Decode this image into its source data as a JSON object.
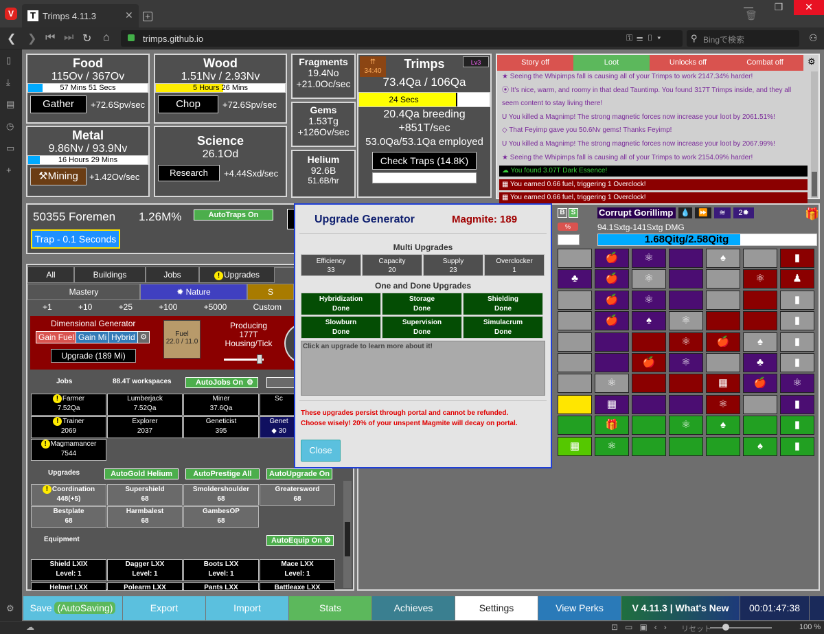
{
  "browser": {
    "tab_title": "Trimps 4.11.3",
    "url": "trimps.github.io",
    "search_placeholder": "Bingで検索",
    "vivaldi_letter": "V",
    "tab_icon_letter": "T",
    "zoom": "100 %",
    "reset_label": "リセット"
  },
  "resources": {
    "food": {
      "title": "Food",
      "amount": "115Ov / 367Ov",
      "bar_text": "57 Mins 51 Secs",
      "bar_fill": 0.12,
      "button": "Gather",
      "rate": "+72.6Spv/sec"
    },
    "wood": {
      "title": "Wood",
      "amount": "1.51Nv / 2.93Nv",
      "bar_text": "5 Hours 26 Mins",
      "bar_fill": 0.52,
      "button": "Chop",
      "rate": "+72.6Spv/sec"
    },
    "metal": {
      "title": "Metal",
      "amount": "9.86Nv / 93.9Nv",
      "bar_text": "16 Hours 29 Mins",
      "bar_fill": 0.1,
      "button": "Mining",
      "rate": "+1.42Ov/sec"
    },
    "science": {
      "title": "Science",
      "amount": "26.1Od",
      "button": "Research",
      "rate": "+4.44Sxd/sec"
    },
    "fragments": {
      "title": "Fragments",
      "amount": "19.4No",
      "rate": "+21.0Oc/sec"
    },
    "gems": {
      "title": "Gems",
      "amount": "1.53Tg",
      "rate": "+126Ov/sec"
    },
    "helium": {
      "title": "Helium",
      "amount": "92.6B",
      "rate": "51.6B/hr"
    }
  },
  "trimps": {
    "title": "Trimps",
    "timer": "34:40",
    "level": "Lv3",
    "amount": "73.4Qa / 106Qa",
    "bar_text": "24 Secs",
    "bar_fill": 0.75,
    "breeding": "20.4Qa breeding",
    "rate": "+851T/sec",
    "employed": "53.0Qa/53.1Qa employed",
    "check_traps": "Check Traps (14.8K)"
  },
  "log": {
    "filters": [
      "Story off",
      "Loot",
      "Unlocks off",
      "Combat off"
    ],
    "filter_colors": [
      "#d9534f",
      "#5cb85c",
      "#d9534f",
      "#d9534f"
    ],
    "rows": [
      {
        "text": "★ Seeing the Whipimps fall is causing all of your Trimps to work 2147.34% harder!",
        "color": "#7a2a9a",
        "bg": "#d0d0d0"
      },
      {
        "text": "⦿ It's nice, warm, and roomy in that dead Tauntimp. You found 317T Trimps inside, and they all",
        "color": "#7a2a9a",
        "bg": "#d0d0d0"
      },
      {
        "text": "seem content to stay living there!",
        "color": "#7a2a9a",
        "bg": "#d0d0d0"
      },
      {
        "text": "U You killed a Magnimp! The strong magnetic forces now increase your loot by 2061.51%!",
        "color": "#7a2a9a",
        "bg": "#d0d0d0"
      },
      {
        "text": "◇ That Feyimp gave you 50.6Nv gems! Thanks Feyimp!",
        "color": "#7a2a9a",
        "bg": "#d0d0d0"
      },
      {
        "text": "U You killed a Magnimp! The strong magnetic forces now increase your loot by 2067.99%!",
        "color": "#7a2a9a",
        "bg": "#d0d0d0"
      },
      {
        "text": "★ Seeing the Whipimps fall is causing all of your Trimps to work 2154.09% harder!",
        "color": "#7a2a9a",
        "bg": "#d0d0d0"
      },
      {
        "text": "☁ You found 3.07T Dark Essence!",
        "color": "#38d038",
        "bg": "#000"
      },
      {
        "text": "▦ You earned 0.66 fuel, triggering 1 Overclock!",
        "color": "#fff",
        "bg": "#8b0000"
      },
      {
        "text": "▦ You earned 0.66 fuel, triggering 1 Overclock!",
        "color": "#fff",
        "bg": "#8b0000"
      }
    ]
  },
  "foremen": {
    "label": "50355 Foremen",
    "percent": "1.26M%",
    "autotraps": "AutoTraps On",
    "trap": "Trap - 0.1 Seconds"
  },
  "tabs": {
    "row1": [
      "All",
      "Buildings",
      "Jobs",
      "Upgrades"
    ],
    "row2": [
      "Mastery",
      "✹ Nature",
      "S"
    ],
    "amounts": [
      "+1",
      "+10",
      "+25",
      "+100",
      "+5000",
      "Custom"
    ]
  },
  "dimgen": {
    "title": "Dimensional Generator",
    "gain_fuel": "Gain Fuel",
    "gain_mi": "Gain Mi",
    "hybrid": "Hybrid",
    "upgrade": "Upgrade (189 Mi)",
    "fuel_label": "Fuel",
    "fuel_value": "22.0 / 11.0",
    "producing": "Producing",
    "producing_value": "177T",
    "housing": "Housing/Tick"
  },
  "jobs": {
    "label": "Jobs",
    "workspaces": "88.4T workspaces",
    "autojobs": "AutoJobs On",
    "cells": [
      {
        "name": "Farmer",
        "value": "7.52Qa",
        "alert": true
      },
      {
        "name": "Lumberjack",
        "value": "7.52Qa",
        "alert": false
      },
      {
        "name": "Miner",
        "value": "37.6Qa",
        "alert": false
      },
      {
        "name": "Sc",
        "value": "",
        "alert": false
      },
      {
        "name": "Trainer",
        "value": "2069",
        "alert": true
      },
      {
        "name": "Explorer",
        "value": "2037",
        "alert": false
      },
      {
        "name": "Geneticist",
        "value": "395",
        "alert": false
      },
      {
        "name": "Genet",
        "value": "◆ 30",
        "alert": false
      },
      {
        "name": "Magmamancer",
        "value": "7544",
        "alert": true
      }
    ]
  },
  "upgrades": {
    "label": "Upgrades",
    "auto": [
      "AutoGold Helium",
      "AutoPrestige All",
      "AutoUpgrade On"
    ],
    "cells": [
      {
        "name": "Coordination",
        "value": "448(+5)",
        "alert": true
      },
      {
        "name": "Supershield",
        "value": "68",
        "alert": false
      },
      {
        "name": "Smoldershoulder",
        "value": "68",
        "alert": false
      },
      {
        "name": "Greatersword",
        "value": "68",
        "alert": false
      },
      {
        "name": "Bestplate",
        "value": "68",
        "alert": false
      },
      {
        "name": "Harmbalest",
        "value": "68",
        "alert": false
      },
      {
        "name": "GambesOP",
        "value": "68",
        "alert": false
      }
    ]
  },
  "equipment": {
    "label": "Equipment",
    "autoequip": "AutoEquip On",
    "cells": [
      {
        "name": "Shield LXIX",
        "value": "Level: 1"
      },
      {
        "name": "Dagger LXX",
        "value": "Level: 1"
      },
      {
        "name": "Boots LXX",
        "value": "Level: 1"
      },
      {
        "name": "Mace LXX",
        "value": "Level: 1"
      },
      {
        "name": "Helmet LXX",
        "value": ""
      },
      {
        "name": "Polearm LXX",
        "value": ""
      },
      {
        "name": "Pants LXX",
        "value": ""
      },
      {
        "name": "Battleaxe LXX",
        "value": ""
      }
    ]
  },
  "enemy": {
    "name": "Corrupt Gorillimp",
    "dmg": "94.1Sxtg-141Sxtg DMG",
    "health": "1.68Qitg/2.58Qitg",
    "health_fill": 0.65,
    "b_label": "B",
    "s_label": "S",
    "count": "2"
  },
  "map": {
    "rows": [
      [
        [
          "#999",
          ""
        ],
        [
          "#4b0d72",
          "🍎"
        ],
        [
          "#4b0d72",
          "⚛"
        ],
        [
          "#4b0d72",
          ""
        ],
        [
          "#999",
          "♠"
        ],
        [
          "#999",
          ""
        ],
        [
          "#8b0000",
          "▮"
        ]
      ],
      [
        [
          "#4b0d72",
          "♣"
        ],
        [
          "#4b0d72",
          "🍎"
        ],
        [
          "#999",
          "⚛"
        ],
        [
          "#4b0d72",
          ""
        ],
        [
          "#999",
          ""
        ],
        [
          "#8b0000",
          "⚛"
        ],
        [
          "#8b0000",
          "♟"
        ]
      ],
      [
        [
          "#999",
          ""
        ],
        [
          "#4b0d72",
          "🍎"
        ],
        [
          "#4b0d72",
          "⚛"
        ],
        [
          "#4b0d72",
          ""
        ],
        [
          "#999",
          ""
        ],
        [
          "#8b0000",
          ""
        ],
        [
          "#999",
          "▮"
        ]
      ],
      [
        [
          "#999",
          ""
        ],
        [
          "#4b0d72",
          "🍎"
        ],
        [
          "#4b0d72",
          "♠"
        ],
        [
          "#999",
          "⚛"
        ],
        [
          "#8b0000",
          ""
        ],
        [
          "#8b0000",
          ""
        ],
        [
          "#999",
          "▮"
        ]
      ],
      [
        [
          "#999",
          ""
        ],
        [
          "#4b0d72",
          ""
        ],
        [
          "#8b0000",
          ""
        ],
        [
          "#8b0000",
          "⚛"
        ],
        [
          "#8b0000",
          "🍎"
        ],
        [
          "#999",
          "♠"
        ],
        [
          "#999",
          "▮"
        ]
      ],
      [
        [
          "#999",
          ""
        ],
        [
          "#4b0d72",
          ""
        ],
        [
          "#8b0000",
          "🍎"
        ],
        [
          "#4b0d72",
          "⚛"
        ],
        [
          "#999",
          ""
        ],
        [
          "#4b0d72",
          "♣"
        ],
        [
          "#999",
          "▮"
        ]
      ],
      [
        [
          "#999",
          ""
        ],
        [
          "#999",
          "⚛"
        ],
        [
          "#8b0000",
          ""
        ],
        [
          "#8b0000",
          ""
        ],
        [
          "#8b0000",
          "▦"
        ],
        [
          "#4b0d72",
          "🍎"
        ],
        [
          "#4b0d72",
          "⚛"
        ]
      ],
      [
        [
          "#ffe600",
          ""
        ],
        [
          "#4b0d72",
          "▦"
        ],
        [
          "#4b0d72",
          ""
        ],
        [
          "#4b0d72",
          ""
        ],
        [
          "#8b0000",
          "⚛"
        ],
        [
          "#999",
          ""
        ],
        [
          "#4b0d72",
          "▮"
        ]
      ],
      [
        [
          "#22a022",
          ""
        ],
        [
          "#22a022",
          "🎁"
        ],
        [
          "#22a022",
          ""
        ],
        [
          "#22a022",
          "⚛"
        ],
        [
          "#22a022",
          "♠"
        ],
        [
          "#22a022",
          ""
        ],
        [
          "#22a022",
          "▮"
        ]
      ],
      [
        [
          "#55c800",
          "▦"
        ],
        [
          "#22a022",
          "⚛"
        ],
        [
          "#22a022",
          ""
        ],
        [
          "#22a022",
          ""
        ],
        [
          "#22a022",
          ""
        ],
        [
          "#22a022",
          "♠"
        ],
        [
          "#22a022",
          "▮"
        ]
      ]
    ]
  },
  "modal": {
    "title": "Upgrade Generator",
    "magmite": "Magmite: 189",
    "multi_title": "Multi Upgrades",
    "multi": [
      {
        "name": "Efficiency",
        "value": "33"
      },
      {
        "name": "Capacity",
        "value": "20"
      },
      {
        "name": "Supply",
        "value": "23"
      },
      {
        "name": "Overclocker",
        "value": "1"
      }
    ],
    "once_title": "One and Done Upgrades",
    "once": [
      {
        "name": "Hybridization",
        "value": "Done"
      },
      {
        "name": "Storage",
        "value": "Done"
      },
      {
        "name": "Shielding",
        "value": "Done"
      },
      {
        "name": "Slowburn",
        "value": "Done"
      },
      {
        "name": "Supervision",
        "value": "Done"
      },
      {
        "name": "Simulacrum",
        "value": "Done"
      }
    ],
    "description": "Click an upgrade to learn more about it!",
    "warning1": "These upgrades persist through portal and cannot be refunded.",
    "warning2": "Choose wisely! 20% of your unspent Magmite will decay on portal.",
    "close": "Close"
  },
  "bottom": {
    "save": "Save",
    "autosaving": "(AutoSaving)",
    "export": "Export",
    "import": "Import",
    "stats": "Stats",
    "achieves": "Achieves",
    "settings": "Settings",
    "view_perks": "View Perks",
    "version": "V 4.11.3 | What's New",
    "time": "00:01:47:38"
  }
}
